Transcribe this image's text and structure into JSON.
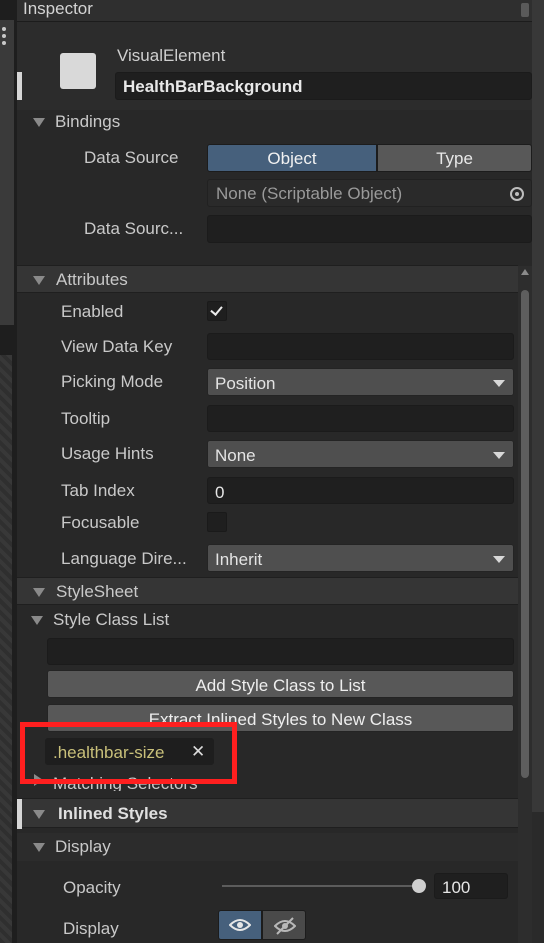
{
  "panel": {
    "title": "Inspector"
  },
  "element": {
    "type_label": "VisualElement",
    "name_value": "HealthBarBackground"
  },
  "bindings": {
    "header": "Bindings",
    "data_source_label": "Data Source",
    "tab_object": "Object",
    "tab_type": "Type",
    "object_field_value": "None (Scriptable Object)",
    "data_source_path_label": "Data Sourc..."
  },
  "attributes": {
    "header": "Attributes",
    "enabled_label": "Enabled",
    "enabled_checked": true,
    "view_data_key_label": "View Data Key",
    "view_data_key_value": "",
    "picking_mode_label": "Picking Mode",
    "picking_mode_value": "Position",
    "tooltip_label": "Tooltip",
    "tooltip_value": "",
    "usage_hints_label": "Usage Hints",
    "usage_hints_value": "None",
    "tab_index_label": "Tab Index",
    "tab_index_value": "0",
    "focusable_label": "Focusable",
    "focusable_checked": false,
    "language_direction_label": "Language Dire...",
    "language_direction_value": "Inherit"
  },
  "stylesheet": {
    "header": "StyleSheet",
    "style_class_list_label": "Style Class List",
    "add_class_button": "Add Style Class to List",
    "extract_button": "Extract Inlined Styles to New Class",
    "class_tag": ".healthbar-size",
    "matching_selectors_label": "Matching Selectors"
  },
  "inlined_styles": {
    "header": "Inlined Styles",
    "display_section": "Display",
    "opacity_label": "Opacity",
    "opacity_value": "100",
    "display_label": "Display"
  },
  "colors": {
    "tag_text": "#c9c07a",
    "highlight_box": "#ff1f1f",
    "tab_selected": "#46607c",
    "accent_bar": "#d6d6d6"
  }
}
